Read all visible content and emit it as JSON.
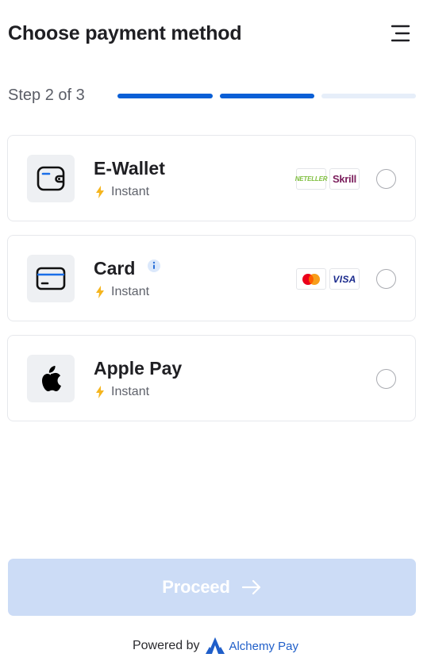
{
  "header": {
    "title": "Choose payment method",
    "menu_icon": "menu-icon"
  },
  "stepper": {
    "label": "Step 2 of 3",
    "current": 2,
    "total": 3,
    "active_color": "#0a5fd6",
    "inactive_color": "#e6eef9"
  },
  "methods": [
    {
      "name": "E-Wallet",
      "speed": "Instant",
      "icon": "wallet-icon",
      "logos": [
        "NETELLER",
        "Skrill"
      ],
      "selected": false
    },
    {
      "name": "Card",
      "speed": "Instant",
      "icon": "card-icon",
      "has_info": true,
      "logos": [
        "mastercard",
        "VISA"
      ],
      "selected": false
    },
    {
      "name": "Apple Pay",
      "speed": "Instant",
      "icon": "apple-icon",
      "logos": [],
      "selected": false
    }
  ],
  "proceed": {
    "label": "Proceed",
    "enabled": false,
    "color": "#ccdcf6"
  },
  "footer": {
    "powered_by": "Powered by",
    "brand": "Alchemy Pay",
    "brand_color": "#1f5ec9"
  }
}
